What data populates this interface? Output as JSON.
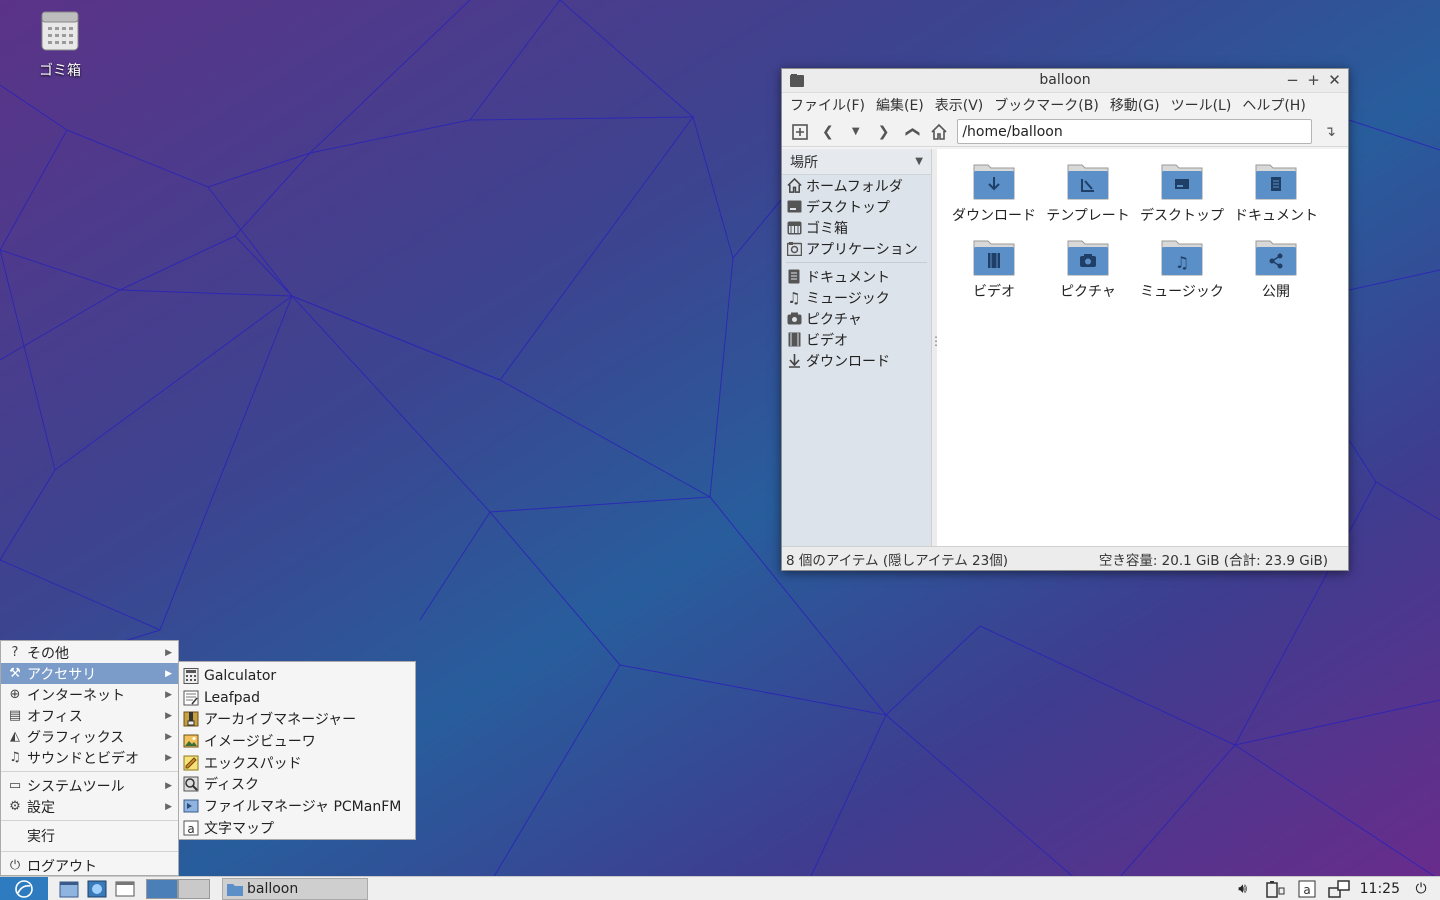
{
  "desktop": {
    "trash_label": "ゴミ箱"
  },
  "window": {
    "title": "balloon",
    "controls": {
      "minimize": "−",
      "maximize": "+",
      "close": "✕"
    },
    "menu": [
      "ファイル(F)",
      "編集(E)",
      "表示(V)",
      "ブックマーク(B)",
      "移動(G)",
      "ツール(L)",
      "ヘルプ(H)"
    ],
    "path": "/home/balloon",
    "sidebar": {
      "header": "場所",
      "places": [
        {
          "label": "ホームフォルダ",
          "icon": "home-icon"
        },
        {
          "label": "デスクトップ",
          "icon": "desktop-icon"
        },
        {
          "label": "ゴミ箱",
          "icon": "trash-icon"
        },
        {
          "label": "アプリケーション",
          "icon": "applications-icon"
        }
      ],
      "bookmarks": [
        {
          "label": "ドキュメント",
          "icon": "document-icon"
        },
        {
          "label": "ミュージック",
          "icon": "music-icon"
        },
        {
          "label": "ピクチャ",
          "icon": "camera-icon"
        },
        {
          "label": "ビデオ",
          "icon": "video-icon"
        },
        {
          "label": "ダウンロード",
          "icon": "download-icon"
        }
      ]
    },
    "files": [
      {
        "label": "ダウンロード",
        "emblem": "download"
      },
      {
        "label": "テンプレート",
        "emblem": "template"
      },
      {
        "label": "デスクトップ",
        "emblem": "desktop"
      },
      {
        "label": "ドキュメント",
        "emblem": "document"
      },
      {
        "label": "ビデオ",
        "emblem": "video"
      },
      {
        "label": "ピクチャ",
        "emblem": "camera"
      },
      {
        "label": "ミュージック",
        "emblem": "music"
      },
      {
        "label": "公開",
        "emblem": "share"
      }
    ],
    "status_left": "8 個のアイテム (隠しアイテム 23個)",
    "status_right": "空き容量: 20.1 GiB (合計: 23.9 GiB)"
  },
  "start_menu": {
    "items": [
      {
        "label": "その他",
        "icon": "?",
        "submenu": true
      },
      {
        "label": "アクセサリ",
        "icon": "⚒",
        "submenu": true,
        "active": true
      },
      {
        "label": "インターネット",
        "icon": "⊕",
        "submenu": true
      },
      {
        "label": "オフィス",
        "icon": "▤",
        "submenu": true
      },
      {
        "label": "グラフィックス",
        "icon": "◭",
        "submenu": true
      },
      {
        "label": "サウンドとビデオ",
        "icon": "♫",
        "submenu": true
      }
    ],
    "items2": [
      {
        "label": "システムツール",
        "icon": "▭",
        "submenu": true
      },
      {
        "label": "設定",
        "icon": "⚙",
        "submenu": true
      }
    ],
    "run": "実行",
    "logout": "ログアウト"
  },
  "accessories_submenu": [
    {
      "label": "Galculator",
      "icon": "calculator-icon"
    },
    {
      "label": "Leafpad",
      "icon": "text-editor-icon"
    },
    {
      "label": "アーカイブマネージャー",
      "icon": "archive-icon"
    },
    {
      "label": "イメージビューワ",
      "icon": "image-viewer-icon"
    },
    {
      "label": "エックスパッド",
      "icon": "notepad-icon"
    },
    {
      "label": "ディスク",
      "icon": "disk-icon"
    },
    {
      "label": "ファイルマネージャ PCManFM",
      "icon": "file-manager-icon"
    },
    {
      "label": "文字マップ",
      "icon": "character-map-icon"
    }
  ],
  "taskbar": {
    "task_label": "balloon",
    "clock": "11:25",
    "colors": {
      "start": "#2e7bbf",
      "pager_active": "#4a7fb8",
      "menu_highlight": "#7b9cc9",
      "folder": "#5a8fc8"
    }
  }
}
